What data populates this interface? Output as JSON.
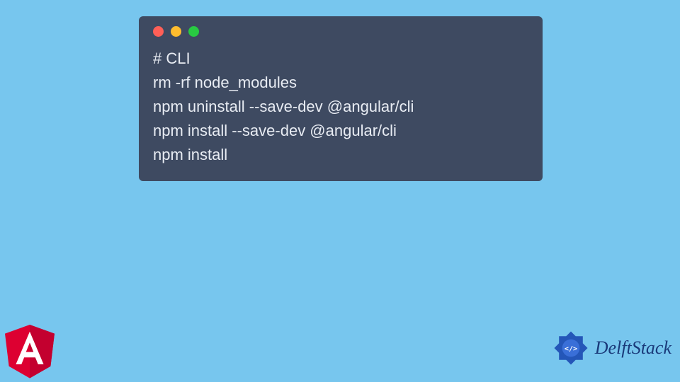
{
  "terminal": {
    "lines": [
      "# CLI",
      "rm -rf node_modules",
      "npm uninstall --save-dev @angular/cli",
      "npm install --save-dev @angular/cli",
      "npm install"
    ]
  },
  "branding": {
    "delftstack_label": "DelftStack"
  },
  "colors": {
    "background": "#77c6ee",
    "terminal_bg": "#3e4a61",
    "terminal_text": "#e8ecf3",
    "angular_red": "#dd0031",
    "delft_blue": "#1a3a7a"
  }
}
